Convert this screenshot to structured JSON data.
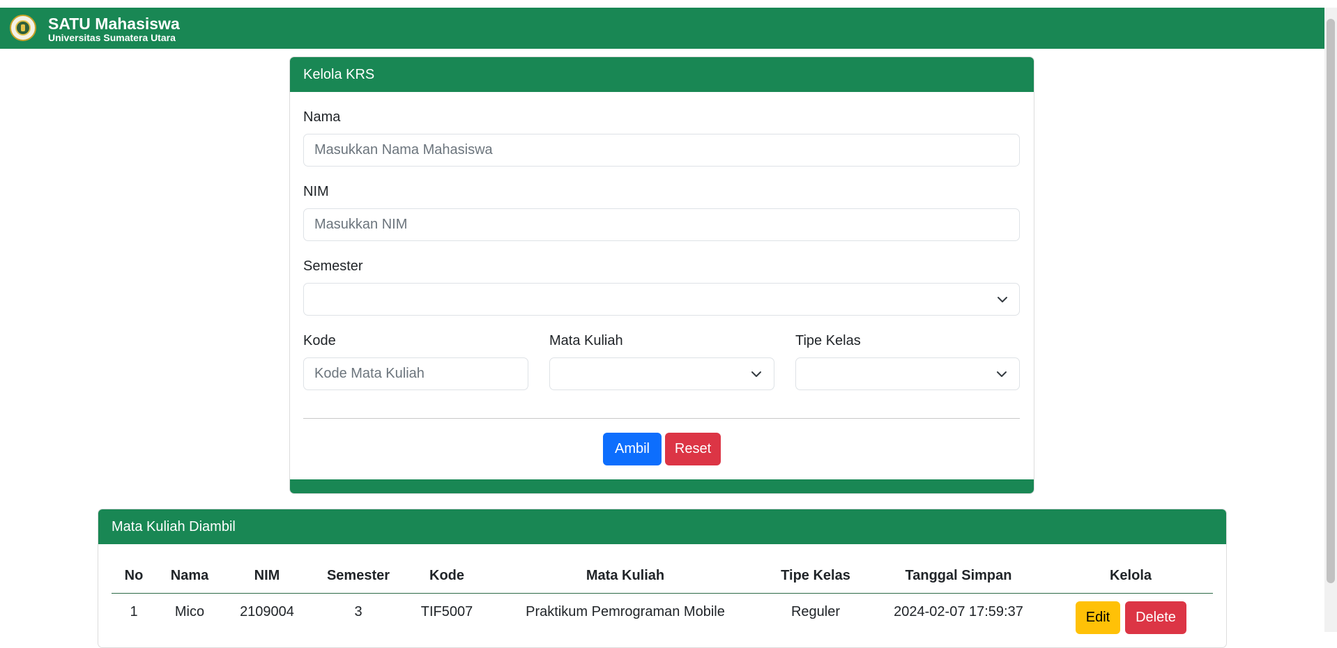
{
  "navbar": {
    "title": "SATU Mahasiswa",
    "subtitle": "Universitas Sumatera Utara",
    "logo_icon": "university-seal-icon"
  },
  "form_card": {
    "header": "Kelola KRS",
    "nama": {
      "label": "Nama",
      "placeholder": "Masukkan Nama Mahasiswa",
      "value": ""
    },
    "nim": {
      "label": "NIM",
      "placeholder": "Masukkan NIM",
      "value": ""
    },
    "semester": {
      "label": "Semester",
      "selected": ""
    },
    "kode": {
      "label": "Kode",
      "placeholder": "Kode Mata Kuliah",
      "value": ""
    },
    "mata_kuliah": {
      "label": "Mata Kuliah",
      "selected": ""
    },
    "tipe_kelas": {
      "label": "Tipe Kelas",
      "selected": ""
    },
    "ambil_button": "Ambil",
    "reset_button": "Reset"
  },
  "table_card": {
    "header": "Mata Kuliah Diambil",
    "columns": [
      "No",
      "Nama",
      "NIM",
      "Semester",
      "Kode",
      "Mata Kuliah",
      "Tipe Kelas",
      "Tanggal Simpan",
      "Kelola"
    ],
    "rows": [
      {
        "no": "1",
        "nama": "Mico",
        "nim": "2109004",
        "semester": "3",
        "kode": "TIF5007",
        "mata_kuliah": "Praktikum Pemrograman Mobile",
        "tipe_kelas": "Reguler",
        "tanggal_simpan": "2024-02-07 17:59:37",
        "edit_label": "Edit",
        "delete_label": "Delete"
      }
    ]
  },
  "colors": {
    "brand_green": "#198754",
    "primary_blue": "#0d6efd",
    "danger_red": "#dc3545",
    "warning_yellow": "#ffc107"
  }
}
